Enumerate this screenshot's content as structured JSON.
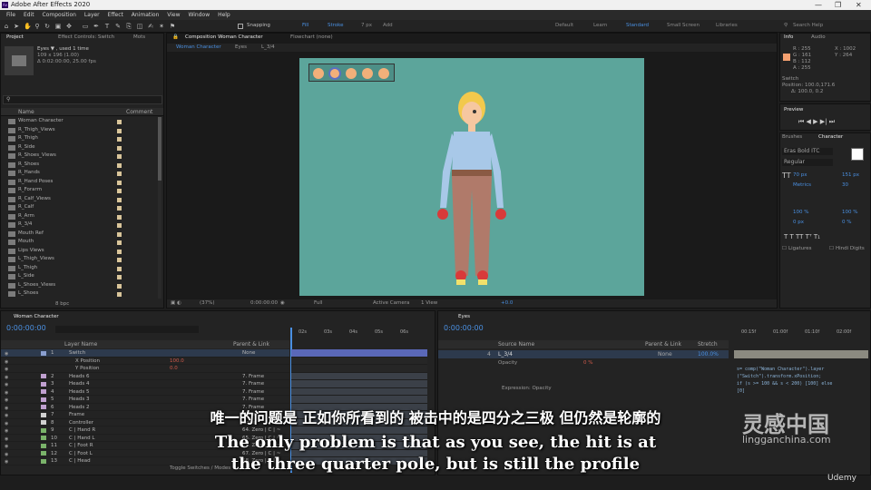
{
  "app_title": "Adobe After Effects 2020",
  "window_controls": [
    "—",
    "❐",
    "✕"
  ],
  "menu": [
    "File",
    "Edit",
    "Composition",
    "Layer",
    "Effect",
    "Animation",
    "View",
    "Window",
    "Help"
  ],
  "toolbar": {
    "snapping": "Snapping",
    "fill": "Fill",
    "stroke": "Stroke",
    "stroke_px": "7 px",
    "add": "Add",
    "workspaces": [
      "Default",
      "Learn",
      "Standard",
      "Small Screen",
      "Libraries"
    ],
    "search_help": "Search Help"
  },
  "project": {
    "tabs": [
      "Project",
      "Effect Controls: Switch",
      "Mots"
    ],
    "info_name": "Eyes ▼ , used 1 time",
    "info_dims": "109 x 196 (1.00)",
    "info_dur": "Δ 0:02:00:00, 25.00 fps",
    "col_name": "Name",
    "col_comment": "Comment",
    "items": [
      "Woman Character",
      "R_Thigh_Views",
      "R_Thigh",
      "R_Side",
      "R_Shoes_Views",
      "R_Shoes",
      "R_Hands",
      "R_Hand Poses",
      "R_Forarm",
      "R_Calf_Views",
      "R_Calf",
      "R_Arm",
      "R_3/4",
      "Mouth Ref",
      "Mouth",
      "Lips Views",
      "L_Thigh_Views",
      "L_Thigh",
      "L_Side",
      "L_Shoes_Views",
      "L_Shoes"
    ],
    "bpc": "8 bpc"
  },
  "composition": {
    "tab": "Composition Woman Character",
    "flowchart": "Flowchart (none)",
    "breadcrumbs": [
      "Woman Character",
      "Eyes",
      "L_3/4"
    ],
    "zoom": "(37%)",
    "time": "0:00:00:00",
    "resolution": "Full",
    "camera": "Active Camera",
    "views": "1 View",
    "exposure": "+0.0"
  },
  "info": {
    "tabs": [
      "Info",
      "Audio"
    ],
    "r": "R : 255",
    "g": "G : 161",
    "b": "B : 112",
    "a": "A : 255",
    "x": "X : 1002",
    "y": "Y : 264",
    "layer": "Switch",
    "position": "Position: 100.0,171.6",
    "delta": "Δ: 100.0, 0.2",
    "swatch": "#f4a070"
  },
  "preview": {
    "title": "Preview"
  },
  "character": {
    "tabs": [
      "Brushes",
      "Character"
    ],
    "font": "Eras Bold ITC",
    "style": "Regular",
    "size": "70 px",
    "leading": "151 px",
    "tracking": "30",
    "metrics": "Metrics",
    "scale_v": "100 %",
    "scale_h": "100 %",
    "baseline": "0 px",
    "tsume": "0 %",
    "ligatures": "Ligatures",
    "hindi_digits": "Hindi Digits"
  },
  "timeline_left": {
    "tab": "Woman Character",
    "time": "0:00:00:00",
    "col_layer": "Layer Name",
    "col_parent": "Parent & Link",
    "ruler": [
      "02s",
      "03s",
      "04s",
      "05s",
      "06s"
    ],
    "layers": [
      {
        "num": "1",
        "name": "Switch",
        "parent": "None",
        "color": "#8a9fd0",
        "selected": true
      },
      {
        "num": "",
        "name": "X Position",
        "parent": "",
        "color": "",
        "value": "100.0"
      },
      {
        "num": "",
        "name": "Y Position",
        "parent": "",
        "color": "",
        "value": "0.0"
      },
      {
        "num": "2",
        "name": "Heads 6",
        "parent": "7. Frame",
        "color": "#c0a0d0"
      },
      {
        "num": "3",
        "name": "Heads 4",
        "parent": "7. Frame",
        "color": "#c0a0d0"
      },
      {
        "num": "4",
        "name": "Heads 5",
        "parent": "7. Frame",
        "color": "#c0a0d0"
      },
      {
        "num": "5",
        "name": "Heads 3",
        "parent": "7. Frame",
        "color": "#c0a0d0"
      },
      {
        "num": "6",
        "name": "Heads 2",
        "parent": "7. Frame",
        "color": "#c0a0d0"
      },
      {
        "num": "7",
        "name": "Frame",
        "parent": "None",
        "color": "#d0d0d0"
      },
      {
        "num": "8",
        "name": "Controller",
        "parent": "None",
        "color": "#d0d0d0"
      },
      {
        "num": "9",
        "name": "C | Hand R",
        "parent": "64. Zero | C | ~",
        "color": "#7ab36a"
      },
      {
        "num": "10",
        "name": "C | Hand L",
        "parent": "65. Zero | C | ~",
        "color": "#7ab36a"
      },
      {
        "num": "11",
        "name": "C | Foot R",
        "parent": "66. Zero | C | ~",
        "color": "#7ab36a"
      },
      {
        "num": "12",
        "name": "C | Foot L",
        "parent": "67. Zero | C | ~",
        "color": "#7ab36a"
      },
      {
        "num": "13",
        "name": "C | Head",
        "parent": "68. Zero | C | ~",
        "color": "#7ab36a"
      }
    ],
    "toggle": "Toggle Switches / Modes"
  },
  "timeline_right": {
    "tab": "Eyes",
    "time": "0:00:00:00",
    "col_source": "Source Name",
    "col_parent": "Parent & Link",
    "col_stretch": "Stretch",
    "ruler": [
      "00:15f",
      "01:00f",
      "01:10f",
      "02:00f"
    ],
    "layer_num": "4",
    "layer_name": "L_3/4",
    "layer_parent": "None",
    "stretch": "100.0%",
    "opacity": "Opacity",
    "opacity_val": "0 %",
    "expression": "Expression: Opacity"
  },
  "expression_code": [
    "s= comp(\"Woman Character\").layer",
    "(\"Switch\").transform.xPosition;",
    "if (s >= 100 && s < 200) [100] else",
    "[0]"
  ],
  "subtitle_cn": "唯一的问题是 正如你所看到的 被击中的是四分之三极 但仍然是轮廓的",
  "subtitle_en": "The only problem is that as you see, the hit is at",
  "subtitle_en2": "the three quarter pole, but is still the profile",
  "watermark": {
    "cn": "灵感中国",
    "en": "lingganchina.com",
    "brand": "Udemy"
  }
}
